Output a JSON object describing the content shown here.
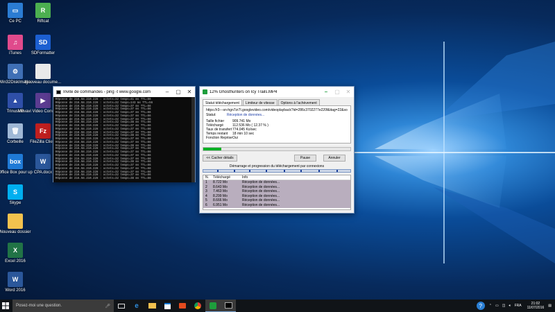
{
  "desktop": {
    "icons": [
      {
        "label": "Ce PC",
        "color": "#2b7cd3",
        "glyph": "▭"
      },
      {
        "label": "Riftcat",
        "color": "#4caf50",
        "glyph": "R"
      },
      {
        "label": "iTunes",
        "color": "#e04a8c",
        "glyph": "♫"
      },
      {
        "label": "SDFormatter",
        "color": "#1c5fd1",
        "glyph": "SD"
      },
      {
        "label": "Win32DiskImager",
        "color": "#3f6fb5",
        "glyph": "⚙"
      },
      {
        "label": "Nouveau docume...",
        "color": "#e9e9e9",
        "glyph": ""
      },
      {
        "label": "TrinusVR",
        "color": "#2f4fa8",
        "glyph": "▲"
      },
      {
        "label": "Movavi Video Converter 16",
        "color": "#5b3c91",
        "glyph": "▶"
      },
      {
        "label": "Corbeille",
        "color": "#9fb8d6",
        "glyph": "🗑"
      },
      {
        "label": "FileZilla Client",
        "color": "#bf1f1f",
        "glyph": "Fz"
      },
      {
        "label": "Office Box pour up",
        "color": "#1f7ad6",
        "glyph": "box"
      },
      {
        "label": "CPA.docx",
        "color": "#2b579a",
        "glyph": "W"
      },
      {
        "label": "Skype",
        "color": "#00aff0",
        "glyph": "S"
      },
      {
        "label": "Nouveau dossier",
        "color": "#f3c24e",
        "glyph": ""
      },
      {
        "label": "Excel 2016",
        "color": "#217346",
        "glyph": "X"
      },
      {
        "label": "Word 2016",
        "color": "#2b579a",
        "glyph": "W"
      }
    ]
  },
  "cmd": {
    "title": "Invite de commandes - ping  -t www.google.com",
    "lines": [
      "Réponse de 216.58.210.228 : octets=32 temps=41 ms TTL=56",
      "Réponse de 216.58.210.228 : octets=32 temps=143 ms TTL=56",
      "Réponse de 216.58.210.228 : octets=32 temps=37 ms TTL=56",
      "Réponse de 216.58.210.228 : octets=32 temps=37 ms TTL=56",
      "Réponse de 216.58.210.228 : octets=32 temps=37 ms TTL=56",
      "Réponse de 216.58.210.228 : octets=32 temps=37 ms TTL=56",
      "Réponse de 216.58.210.228 : octets=32 temps=37 ms TTL=56",
      "Réponse de 216.58.210.228 : octets=32 temps=38 ms TTL=56",
      "Réponse de 216.58.210.228 : octets=32 temps=37 ms TTL=56",
      "Réponse de 216.58.210.228 : octets=32 temps=37 ms TTL=56",
      "Réponse de 216.58.210.228 : octets=32 temps=37 ms TTL=56",
      "Réponse de 216.58.210.228 : octets=32 temps=38 ms TTL=56",
      "Réponse de 216.58.210.228 : octets=32 temps=37 ms TTL=56",
      "Réponse de 216.58.210.228 : octets=32 temps=37 ms TTL=56",
      "Réponse de 216.58.210.228 : octets=32 temps=38 ms TTL=56",
      "Réponse de 216.58.210.228 : octets=32 temps=37 ms TTL=56",
      "Réponse de 216.58.210.228 : octets=32 temps=37 ms TTL=56",
      "Réponse de 216.58.210.228 : octets=32 temps=37 ms TTL=56",
      "Réponse de 216.58.210.228 : octets=32 temps=37 ms TTL=56",
      "Réponse de 216.58.210.228 : octets=32 temps=38 ms TTL=56",
      "Réponse de 216.58.210.228 : octets=32 temps=37 ms TTL=56",
      "Réponse de 216.58.210.228 : octets=32 temps=37 ms TTL=56",
      "Réponse de 216.58.210.228 : octets=32 temps=37 ms TTL=56",
      "Réponse de 216.58.210.228 : octets=32 temps=37 ms TTL=56",
      "Réponse de 216.58.210.228 : octets=32 temps=38 ms TTL=56"
    ]
  },
  "idm": {
    "title": "12% Ghosthunters on Icy Trails.MP4",
    "tabs": [
      "Statut téléchargement",
      "Limiteur de vitesse",
      "Options à l'achèvement"
    ],
    "url": "https://r3---sn-hgn7zr7l.googlevideo.com/videoplayback?id=286c3702277e220f&itag=22&source=web",
    "status_label": "Statut:",
    "status_value": "Réception de données...",
    "fields": [
      {
        "k": "Taille fichier",
        "v": "909.741  Mo"
      },
      {
        "k": "Téléchargé",
        "v": "112.536  Mo  ( 12.37 % )"
      },
      {
        "k": "Taux de transfert",
        "v": "774.045  Ko/sec"
      },
      {
        "k": "Temps restant",
        "v": "18 min 10 sec"
      },
      {
        "k": "Fonction Reprise",
        "v": "Oui"
      }
    ],
    "progress": 0.1237,
    "hide_button": "<< Cacher détails",
    "pause_button": "Pause",
    "cancel_button": "Annuler",
    "connections_caption": "Démarrage et progression du téléchargement par connexions",
    "table_headers": [
      "N.",
      "Téléchargé",
      "Info"
    ],
    "table_rows": [
      [
        "1",
        "8.722  Mo",
        "Réception de données..."
      ],
      [
        "2",
        "8.643  Mo",
        "Réception de données..."
      ],
      [
        "3",
        "7.463  Mo",
        "Réception de données..."
      ],
      [
        "4",
        "8.299  Mo",
        "Réception de données..."
      ],
      [
        "5",
        "8.666  Mo",
        "Réception de données..."
      ],
      [
        "6",
        "6.951  Mo",
        "Réception de données..."
      ]
    ]
  },
  "taskbar": {
    "search_placeholder": "Posez-moi une question.",
    "language": "FRA",
    "time": "21:02",
    "date": "11/07/2016"
  },
  "colors": {
    "accent": "#0078d7",
    "progress": "#06b025",
    "taskbar": "#101418"
  }
}
